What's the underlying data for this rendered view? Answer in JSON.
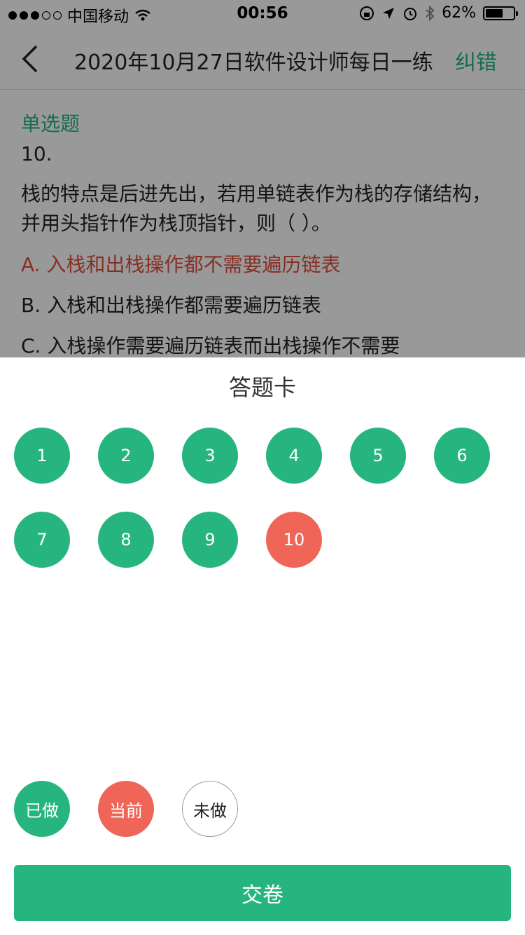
{
  "status_bar": {
    "carrier": "中国移动",
    "time": "00:56",
    "battery": "62%"
  },
  "header": {
    "title": "2020年10月27日软件设计师每日一练",
    "action": "纠错"
  },
  "question": {
    "type": "单选题",
    "number": "10.",
    "text": " 栈的特点是后进先出，若用单链表作为栈的存储结构，并用头指针作为栈顶指针，则（ ）。",
    "options": [
      "A. 入栈和出栈操作都不需要遍历链表",
      "B. 入栈和出栈操作都需要遍历链表",
      "C. 入栈操作需要遍历链表而出栈操作不需要"
    ]
  },
  "answer_card": {
    "title": "答题卡",
    "items": [
      "1",
      "2",
      "3",
      "4",
      "5",
      "6",
      "7",
      "8",
      "9",
      "10"
    ],
    "legend": {
      "done": "已做",
      "current": "当前",
      "todo": "未做"
    },
    "submit": "交卷"
  },
  "colors": {
    "done": "#27b57f",
    "current": "#ef6659"
  }
}
